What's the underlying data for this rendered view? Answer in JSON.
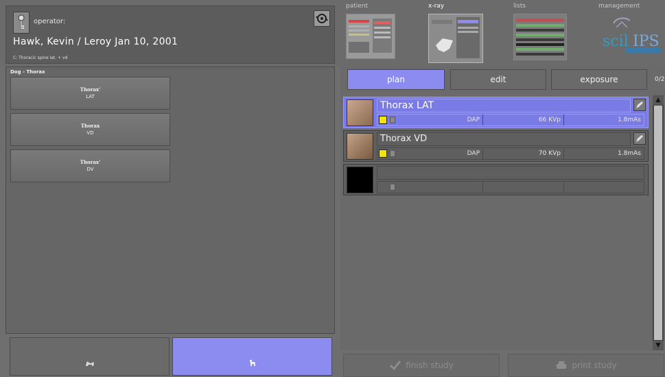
{
  "header": {
    "operator_label": "operator:",
    "patient_name": "Hawk, Kevin / Leroy  Jan 10, 2001",
    "study_description": "C: Thoracic spine lat. + vd",
    "key_icon": "key-icon",
    "switch_icon": "switch-user-icon"
  },
  "modules": {
    "patient": "patient",
    "xray": "x-ray",
    "lists": "lists",
    "management": "management",
    "logo_text": "scil IPS",
    "logo_sub": "Image Processing"
  },
  "left_panel": {
    "group_title": "Dog - Thorax",
    "procedures": [
      {
        "title": "Thorax'",
        "view": "LAT"
      },
      {
        "title": "Thorax",
        "view": "VD"
      },
      {
        "title": "Thorax'",
        "view": "DV"
      }
    ]
  },
  "species": {
    "cat_icon": "cat-icon",
    "dog_icon": "dog-icon",
    "selected": "dog"
  },
  "right_panel": {
    "tabs": {
      "plan": "plan",
      "edit": "edit",
      "exposure": "exposure"
    },
    "counter": "0/2",
    "exposures": [
      {
        "name": "Thorax LAT",
        "dap": "DAP",
        "kvp": "66 KVp",
        "mas": "1.8mAs",
        "selected": true
      },
      {
        "name": "Thorax VD",
        "dap": "DAP",
        "kvp": "70 KVp",
        "mas": "1.8mAs",
        "selected": false
      },
      {
        "name": "",
        "dap": "",
        "kvp": "",
        "mas": "",
        "selected": false
      }
    ]
  },
  "footer": {
    "finish_study": "finish study",
    "print_study": "print study"
  },
  "colors": {
    "accent": "#8c8cf0",
    "selected_row": "#7b7be6",
    "background": "#6e6e6e"
  }
}
